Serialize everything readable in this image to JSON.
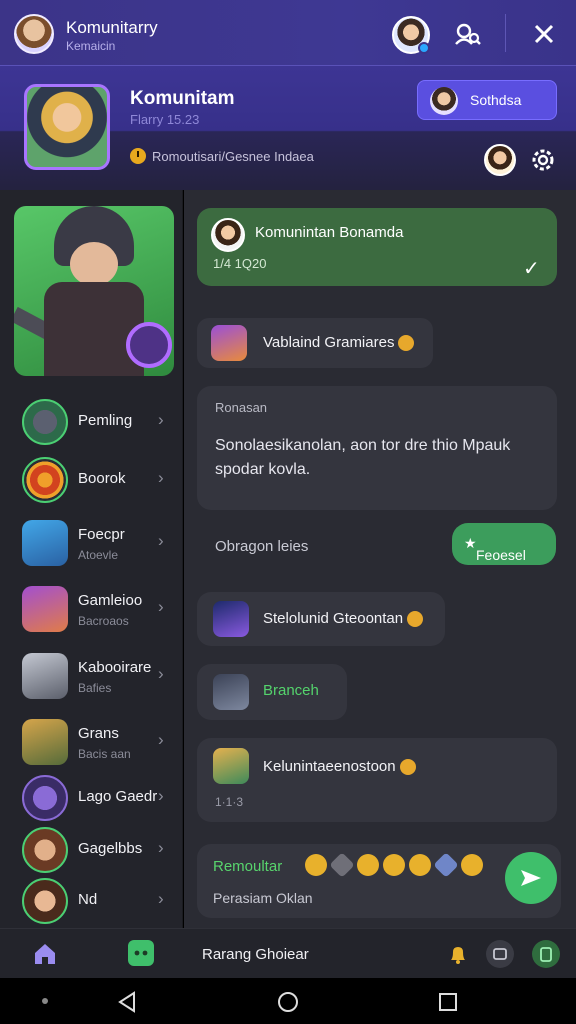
{
  "topbar": {
    "title": "Komunitarry",
    "subtitle": "Kemaicin"
  },
  "header": {
    "title": "Komunitam",
    "subtitle": "Flarry 15.23",
    "join_button": "Sothdsa",
    "info_text": "Romoutisari/Gesnee Indaea"
  },
  "sidebar": {
    "items": [
      {
        "label": "Pemling",
        "sub": ""
      },
      {
        "label": "Boorok",
        "sub": ""
      },
      {
        "label": "Foecpr",
        "sub": "Atoevle"
      },
      {
        "label": "Gamleioo",
        "sub": "Bacroaos"
      },
      {
        "label": "Kabooirare",
        "sub": "Bafies"
      },
      {
        "label": "Grans",
        "sub": "Bacis aan"
      },
      {
        "label": "Lago Gaedr",
        "sub": ""
      },
      {
        "label": "Gagelbbs",
        "sub": ""
      },
      {
        "label": "Nd",
        "sub": ""
      }
    ]
  },
  "chat": {
    "pinned": {
      "name": "Komunintan Bonamda",
      "meta": "1/4 1Q20"
    },
    "msg1": "Vablaind Gramiares",
    "msg2_header": "Ronasan",
    "msg2_body": "Sonolaesikanolan, aon tor dre thio Mpauk spodar kovla.",
    "msg3": "Obragon leies",
    "reply_pill": "Feoesel",
    "msg4": "Stelolunid Gteoontan",
    "msg5": "Branceh",
    "msg6": "Kelunintaeenostoon",
    "msg6_meta": "1·1·3"
  },
  "composer": {
    "label": "Remoultar",
    "placeholder": "Perasiam Oklan"
  },
  "bottombar": {
    "label": "Rarang Ghoiear"
  },
  "colors": {
    "accent": "#3c3488",
    "green": "#3fbf6b",
    "bubble": "#3c6b40"
  }
}
